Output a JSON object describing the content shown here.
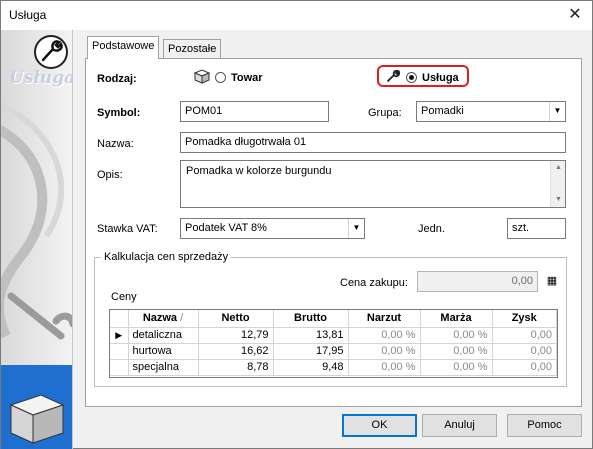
{
  "window": {
    "title": "Usługa",
    "close": "✕"
  },
  "sidebar": {
    "label": "Usługa"
  },
  "tabs": [
    {
      "label": "Podstawowe"
    },
    {
      "label": "Pozostałe"
    }
  ],
  "form": {
    "rodzaj_label": "Rodzaj:",
    "option_towar": "Towar",
    "option_usluga": "Usługa",
    "selected_type": "Usługa",
    "symbol_label": "Symbol:",
    "symbol_value": "POM01",
    "grupa_label": "Grupa:",
    "grupa_value": "Pomadki",
    "nazwa_label": "Nazwa:",
    "nazwa_value": "Pomadka długotrwała 01",
    "opis_label": "Opis:",
    "opis_value": "Pomadka w kolorze burgundu",
    "vat_label": "Stawka VAT:",
    "vat_value": "Podatek VAT 8%",
    "jedn_label": "Jedn.",
    "jedn_value": "szt."
  },
  "calc": {
    "title": "Kalkulacja cen sprzedaży",
    "cena_zakupu_label": "Cena zakupu:",
    "cena_zakupu_value": "0,00",
    "calc_icon": "▦",
    "ceny_label": "Ceny",
    "columns": [
      "Nazwa",
      "Netto",
      "Brutto",
      "Narzut",
      "Marża",
      "Zysk"
    ],
    "sort_mark": "/",
    "rows": [
      {
        "nazwa": "detaliczna",
        "netto": "12,79",
        "brutto": "13,81",
        "narzut": "0,00 %",
        "marza": "0,00 %",
        "zysk": "0,00"
      },
      {
        "nazwa": "hurtowa",
        "netto": "16,62",
        "brutto": "17,95",
        "narzut": "0,00 %",
        "marza": "0,00 %",
        "zysk": "0,00"
      },
      {
        "nazwa": "specjalna",
        "netto": "8,78",
        "brutto": "9,48",
        "narzut": "0,00 %",
        "marza": "0,00 %",
        "zysk": "0,00"
      }
    ],
    "current_row_marker": "▶"
  },
  "buttons": {
    "ok": "OK",
    "cancel": "Anuluj",
    "help": "Pomoc"
  },
  "colors": {
    "highlight": "#e21b1b",
    "accent": "#0078d7"
  }
}
